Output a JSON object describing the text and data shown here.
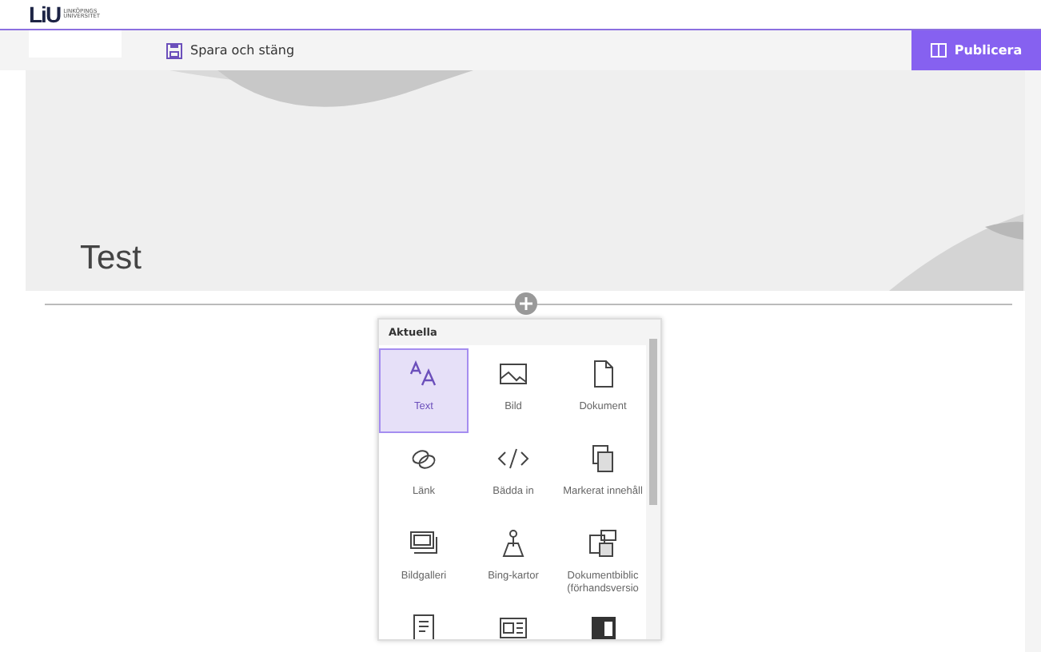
{
  "logo": {
    "mark": "LiU",
    "name": "LINKÖPINGS UNIVERSITET"
  },
  "command_bar": {
    "save": "Spara och stäng",
    "publish": "Publicera"
  },
  "hero": {
    "title": "Test"
  },
  "picker": {
    "section": "Aktuella",
    "tiles": [
      {
        "kind": "text",
        "label": "Text",
        "selected": true
      },
      {
        "kind": "image",
        "label": "Bild",
        "selected": false
      },
      {
        "kind": "document",
        "label": "Dokument",
        "selected": false
      },
      {
        "kind": "link",
        "label": "Länk",
        "selected": false
      },
      {
        "kind": "embed",
        "label": "Bädda in",
        "selected": false
      },
      {
        "kind": "highlighted",
        "label": "Markerat innehåll",
        "selected": false
      },
      {
        "kind": "gallery",
        "label": "Bildgalleri",
        "selected": false
      },
      {
        "kind": "map",
        "label": "Bing-kartor",
        "selected": false
      },
      {
        "kind": "library",
        "label": "Dokumentbiblic (förhandsversio",
        "selected": false
      },
      {
        "kind": "page",
        "selected": false
      },
      {
        "kind": "news",
        "selected": false
      },
      {
        "kind": "app",
        "selected": false
      }
    ]
  }
}
